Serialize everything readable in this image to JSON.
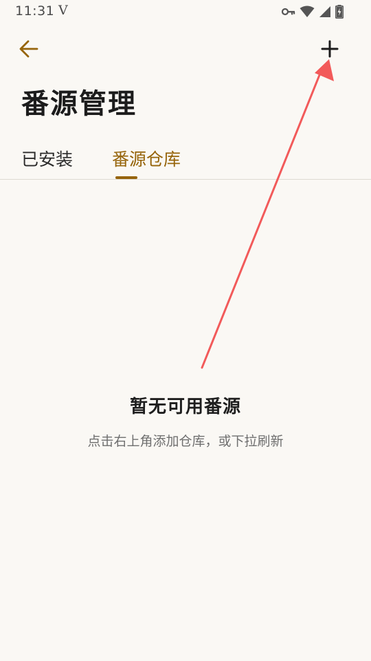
{
  "status_bar": {
    "time": "11:31",
    "carrier_glyph": "V",
    "icons": [
      "vpn-key-icon",
      "wifi-icon",
      "cellular-signal-icon",
      "battery-charging-icon"
    ]
  },
  "app_bar": {
    "back_icon": "arrow-left-icon",
    "add_icon": "plus-icon"
  },
  "page": {
    "title": "番源管理"
  },
  "tabs": [
    {
      "label": "已安装",
      "active": false
    },
    {
      "label": "番源仓库",
      "active": true
    }
  ],
  "empty_state": {
    "title": "暂无可用番源",
    "description": "点击右上角添加仓库，或下拉刷新"
  },
  "colors": {
    "accent": "#96640a",
    "background": "#faf8f4",
    "annotation": "#f25a5a"
  }
}
